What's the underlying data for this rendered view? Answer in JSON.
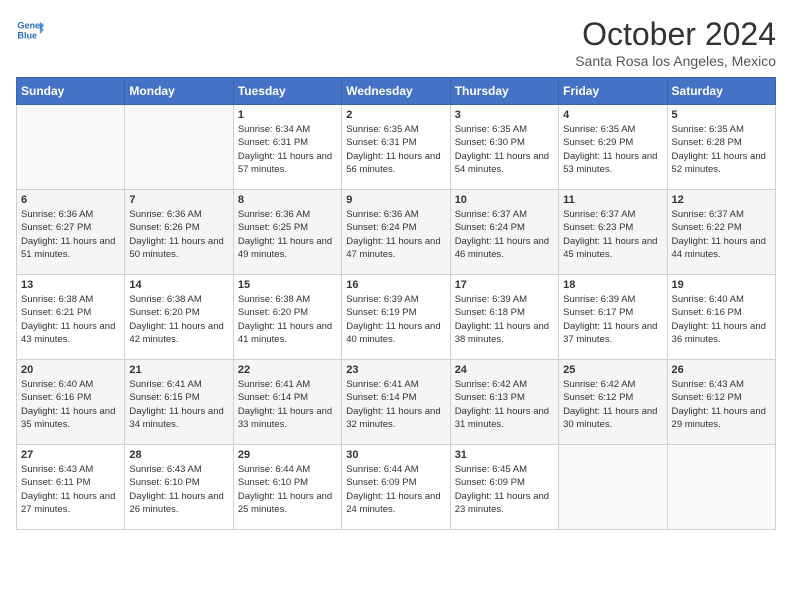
{
  "header": {
    "logo_line1": "General",
    "logo_line2": "Blue",
    "month": "October 2024",
    "location": "Santa Rosa los Angeles, Mexico"
  },
  "days_of_week": [
    "Sunday",
    "Monday",
    "Tuesday",
    "Wednesday",
    "Thursday",
    "Friday",
    "Saturday"
  ],
  "weeks": [
    [
      {
        "day": "",
        "info": ""
      },
      {
        "day": "",
        "info": ""
      },
      {
        "day": "1",
        "info": "Sunrise: 6:34 AM\nSunset: 6:31 PM\nDaylight: 11 hours and 57 minutes."
      },
      {
        "day": "2",
        "info": "Sunrise: 6:35 AM\nSunset: 6:31 PM\nDaylight: 11 hours and 56 minutes."
      },
      {
        "day": "3",
        "info": "Sunrise: 6:35 AM\nSunset: 6:30 PM\nDaylight: 11 hours and 54 minutes."
      },
      {
        "day": "4",
        "info": "Sunrise: 6:35 AM\nSunset: 6:29 PM\nDaylight: 11 hours and 53 minutes."
      },
      {
        "day": "5",
        "info": "Sunrise: 6:35 AM\nSunset: 6:28 PM\nDaylight: 11 hours and 52 minutes."
      }
    ],
    [
      {
        "day": "6",
        "info": "Sunrise: 6:36 AM\nSunset: 6:27 PM\nDaylight: 11 hours and 51 minutes."
      },
      {
        "day": "7",
        "info": "Sunrise: 6:36 AM\nSunset: 6:26 PM\nDaylight: 11 hours and 50 minutes."
      },
      {
        "day": "8",
        "info": "Sunrise: 6:36 AM\nSunset: 6:25 PM\nDaylight: 11 hours and 49 minutes."
      },
      {
        "day": "9",
        "info": "Sunrise: 6:36 AM\nSunset: 6:24 PM\nDaylight: 11 hours and 47 minutes."
      },
      {
        "day": "10",
        "info": "Sunrise: 6:37 AM\nSunset: 6:24 PM\nDaylight: 11 hours and 46 minutes."
      },
      {
        "day": "11",
        "info": "Sunrise: 6:37 AM\nSunset: 6:23 PM\nDaylight: 11 hours and 45 minutes."
      },
      {
        "day": "12",
        "info": "Sunrise: 6:37 AM\nSunset: 6:22 PM\nDaylight: 11 hours and 44 minutes."
      }
    ],
    [
      {
        "day": "13",
        "info": "Sunrise: 6:38 AM\nSunset: 6:21 PM\nDaylight: 11 hours and 43 minutes."
      },
      {
        "day": "14",
        "info": "Sunrise: 6:38 AM\nSunset: 6:20 PM\nDaylight: 11 hours and 42 minutes."
      },
      {
        "day": "15",
        "info": "Sunrise: 6:38 AM\nSunset: 6:20 PM\nDaylight: 11 hours and 41 minutes."
      },
      {
        "day": "16",
        "info": "Sunrise: 6:39 AM\nSunset: 6:19 PM\nDaylight: 11 hours and 40 minutes."
      },
      {
        "day": "17",
        "info": "Sunrise: 6:39 AM\nSunset: 6:18 PM\nDaylight: 11 hours and 38 minutes."
      },
      {
        "day": "18",
        "info": "Sunrise: 6:39 AM\nSunset: 6:17 PM\nDaylight: 11 hours and 37 minutes."
      },
      {
        "day": "19",
        "info": "Sunrise: 6:40 AM\nSunset: 6:16 PM\nDaylight: 11 hours and 36 minutes."
      }
    ],
    [
      {
        "day": "20",
        "info": "Sunrise: 6:40 AM\nSunset: 6:16 PM\nDaylight: 11 hours and 35 minutes."
      },
      {
        "day": "21",
        "info": "Sunrise: 6:41 AM\nSunset: 6:15 PM\nDaylight: 11 hours and 34 minutes."
      },
      {
        "day": "22",
        "info": "Sunrise: 6:41 AM\nSunset: 6:14 PM\nDaylight: 11 hours and 33 minutes."
      },
      {
        "day": "23",
        "info": "Sunrise: 6:41 AM\nSunset: 6:14 PM\nDaylight: 11 hours and 32 minutes."
      },
      {
        "day": "24",
        "info": "Sunrise: 6:42 AM\nSunset: 6:13 PM\nDaylight: 11 hours and 31 minutes."
      },
      {
        "day": "25",
        "info": "Sunrise: 6:42 AM\nSunset: 6:12 PM\nDaylight: 11 hours and 30 minutes."
      },
      {
        "day": "26",
        "info": "Sunrise: 6:43 AM\nSunset: 6:12 PM\nDaylight: 11 hours and 29 minutes."
      }
    ],
    [
      {
        "day": "27",
        "info": "Sunrise: 6:43 AM\nSunset: 6:11 PM\nDaylight: 11 hours and 27 minutes."
      },
      {
        "day": "28",
        "info": "Sunrise: 6:43 AM\nSunset: 6:10 PM\nDaylight: 11 hours and 26 minutes."
      },
      {
        "day": "29",
        "info": "Sunrise: 6:44 AM\nSunset: 6:10 PM\nDaylight: 11 hours and 25 minutes."
      },
      {
        "day": "30",
        "info": "Sunrise: 6:44 AM\nSunset: 6:09 PM\nDaylight: 11 hours and 24 minutes."
      },
      {
        "day": "31",
        "info": "Sunrise: 6:45 AM\nSunset: 6:09 PM\nDaylight: 11 hours and 23 minutes."
      },
      {
        "day": "",
        "info": ""
      },
      {
        "day": "",
        "info": ""
      }
    ]
  ]
}
